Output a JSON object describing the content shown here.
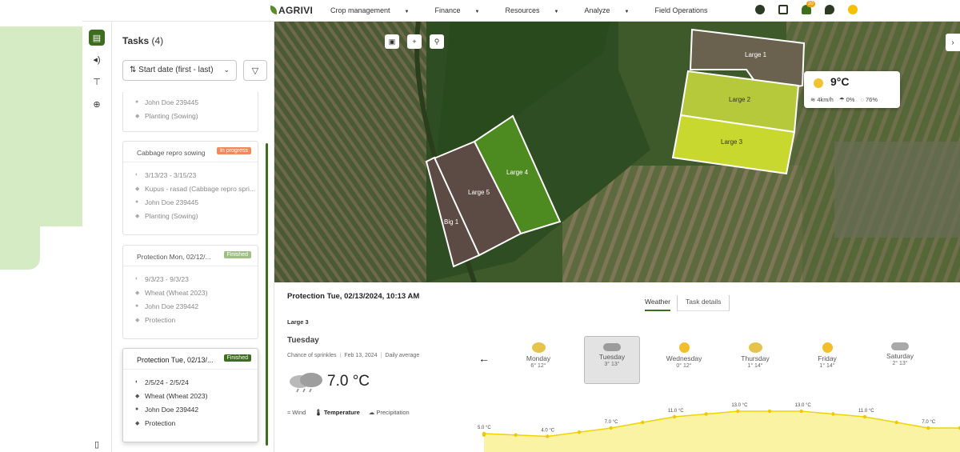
{
  "nav": {
    "logo": "AGRIVI",
    "menu": [
      {
        "label": "Crop management",
        "caret": true
      },
      {
        "label": "Finance",
        "caret": true
      },
      {
        "label": "Resources",
        "caret": true
      },
      {
        "label": "Analyze",
        "caret": true
      },
      {
        "label": "Field Operations",
        "caret": false
      }
    ],
    "notifications_badge": "20"
  },
  "tasks": {
    "title": "Tasks",
    "count": "(4)",
    "sort_label": "Start date (first - last)",
    "cards": [
      {
        "name": "",
        "status": "",
        "rows": [
          "John Doe 239445",
          "Planting (Sowing)"
        ]
      },
      {
        "name": "Cabbage repro sowing",
        "status": "In progress",
        "rows": [
          "3/13/23 - 3/15/23",
          "Kupus - rasad (Cabbage repro spri...",
          "John Doe 239445",
          "Planting (Sowing)"
        ]
      },
      {
        "name": "Protection Mon, 02/12/...",
        "status": "Finished",
        "rows": [
          "9/3/23 - 9/3/23",
          "Wheat (Wheat 2023)",
          "John Doe 239442",
          "Protection"
        ]
      },
      {
        "name": "Protection Tue, 02/13/...",
        "status": "Finished",
        "rows": [
          "2/5/24 - 2/5/24",
          "Wheat (Wheat 2023)",
          "John Doe 239442",
          "Protection"
        ]
      }
    ]
  },
  "map": {
    "fields": [
      "Large 1",
      "Large 2",
      "Large 3",
      "Large 4",
      "Large 5",
      "Big 1"
    ],
    "popup": {
      "temp": "9°C",
      "wind": "4km/h",
      "precip": "0%",
      "humidity": "76%"
    }
  },
  "detail": {
    "title": "Protection Tue, 02/13/2024, 10:13 AM",
    "field": "Large 3",
    "day": "Tuesday",
    "condition": "Chance of sprinkles",
    "date": "Feb 13, 2024",
    "average": "Daily average",
    "temp": "7.0 °C",
    "metrics": [
      "Wind",
      "Temperature",
      "Precipitation"
    ],
    "tabs": [
      "Weather",
      "Task details"
    ],
    "forecast": [
      {
        "day": "Monday",
        "range": "6° 12°",
        "icon": "partly-sunny-icon"
      },
      {
        "day": "Tuesday",
        "range": "3° 13°",
        "icon": "cloud-rain-icon"
      },
      {
        "day": "Wednesday",
        "range": "0° 12°",
        "icon": "sun-icon"
      },
      {
        "day": "Thursday",
        "range": "1° 14°",
        "icon": "partly-sunny-icon"
      },
      {
        "day": "Friday",
        "range": "1° 14°",
        "icon": "sun-icon"
      },
      {
        "day": "Saturday",
        "range": "2° 13°",
        "icon": "cloud-icon"
      }
    ]
  },
  "chart_data": {
    "type": "area",
    "labels": [
      "5.0 °C",
      "4.0 °C",
      "7.0 °C",
      "11.0 °C",
      "13.0 °C",
      "13.0 °C",
      "11.0 °C",
      "7.0 °C"
    ],
    "values": [
      5,
      4,
      7,
      11,
      13,
      13,
      11,
      7
    ]
  }
}
